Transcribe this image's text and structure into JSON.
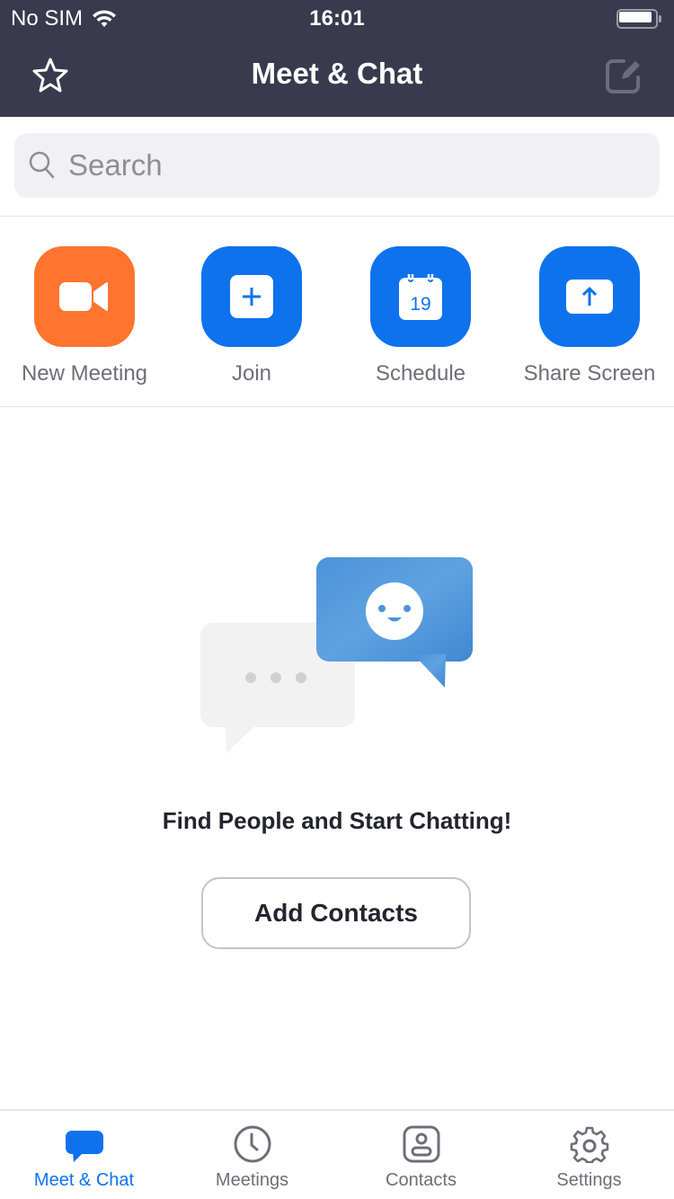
{
  "status_bar": {
    "carrier": "No SIM",
    "time": "16:01",
    "wifi_icon": "wifi-icon",
    "battery_icon": "battery-icon"
  },
  "header": {
    "title": "Meet & Chat",
    "left_icon": "star-icon",
    "right_icon": "compose-icon"
  },
  "search": {
    "placeholder": "Search",
    "value": "",
    "icon": "search-icon"
  },
  "actions": [
    {
      "label": "New Meeting",
      "icon": "video-camera-icon",
      "color": "#ff742e"
    },
    {
      "label": "Join",
      "icon": "plus-icon",
      "color": "#0e72ed"
    },
    {
      "label": "Schedule",
      "icon": "calendar-icon",
      "calendar_day": "19",
      "color": "#0e72ed"
    },
    {
      "label": "Share Screen",
      "icon": "share-screen-icon",
      "color": "#0e72ed"
    }
  ],
  "empty_state": {
    "illustration": "chat-bubbles-illustration",
    "title": "Find People and Start Chatting!",
    "button_label": "Add Contacts"
  },
  "tab_bar": {
    "active_color": "#0e72ed",
    "inactive_color": "#6e6e78",
    "tabs": [
      {
        "label": "Meet & Chat",
        "icon": "chat-bubble-icon",
        "active": true
      },
      {
        "label": "Meetings",
        "icon": "clock-icon",
        "active": false
      },
      {
        "label": "Contacts",
        "icon": "contact-card-icon",
        "active": false
      },
      {
        "label": "Settings",
        "icon": "gear-icon",
        "active": false
      }
    ]
  }
}
